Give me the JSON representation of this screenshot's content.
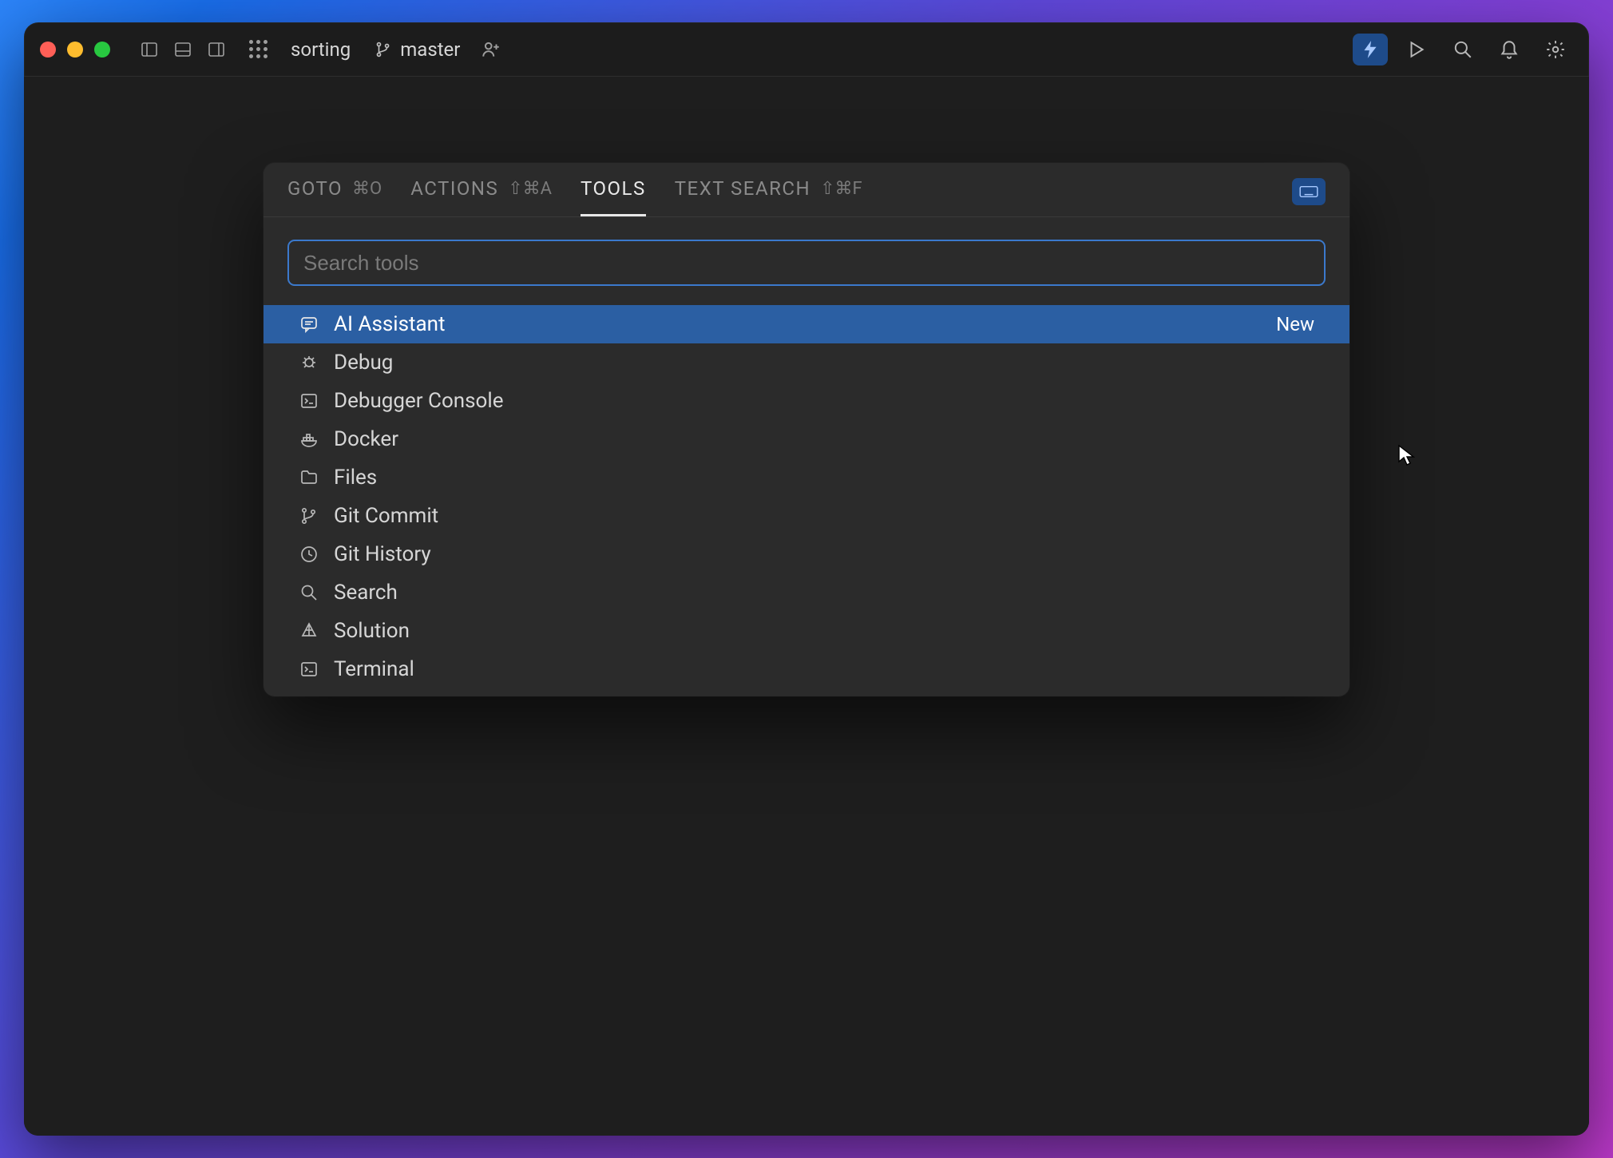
{
  "titlebar": {
    "project_name": "sorting",
    "branch_name": "master"
  },
  "popup": {
    "tabs": [
      {
        "label": "GOTO",
        "shortcut": "⌘O"
      },
      {
        "label": "ACTIONS",
        "shortcut": "⇧⌘A"
      },
      {
        "label": "TOOLS",
        "shortcut": ""
      },
      {
        "label": "TEXT SEARCH",
        "shortcut": "⇧⌘F"
      }
    ],
    "active_tab_index": 2,
    "search": {
      "placeholder": "Search tools",
      "value": ""
    },
    "tools": [
      {
        "icon": "chat-bubble",
        "label": "AI Assistant",
        "badge": "New",
        "selected": true
      },
      {
        "icon": "bug",
        "label": "Debug",
        "badge": "",
        "selected": false
      },
      {
        "icon": "console",
        "label": "Debugger Console",
        "badge": "",
        "selected": false
      },
      {
        "icon": "docker",
        "label": "Docker",
        "badge": "",
        "selected": false
      },
      {
        "icon": "folder",
        "label": "Files",
        "badge": "",
        "selected": false
      },
      {
        "icon": "git-branch",
        "label": "Git Commit",
        "badge": "",
        "selected": false
      },
      {
        "icon": "clock",
        "label": "Git History",
        "badge": "",
        "selected": false
      },
      {
        "icon": "search",
        "label": "Search",
        "badge": "",
        "selected": false
      },
      {
        "icon": "solution",
        "label": "Solution",
        "badge": "",
        "selected": false
      },
      {
        "icon": "terminal",
        "label": "Terminal",
        "badge": "",
        "selected": false
      }
    ]
  }
}
